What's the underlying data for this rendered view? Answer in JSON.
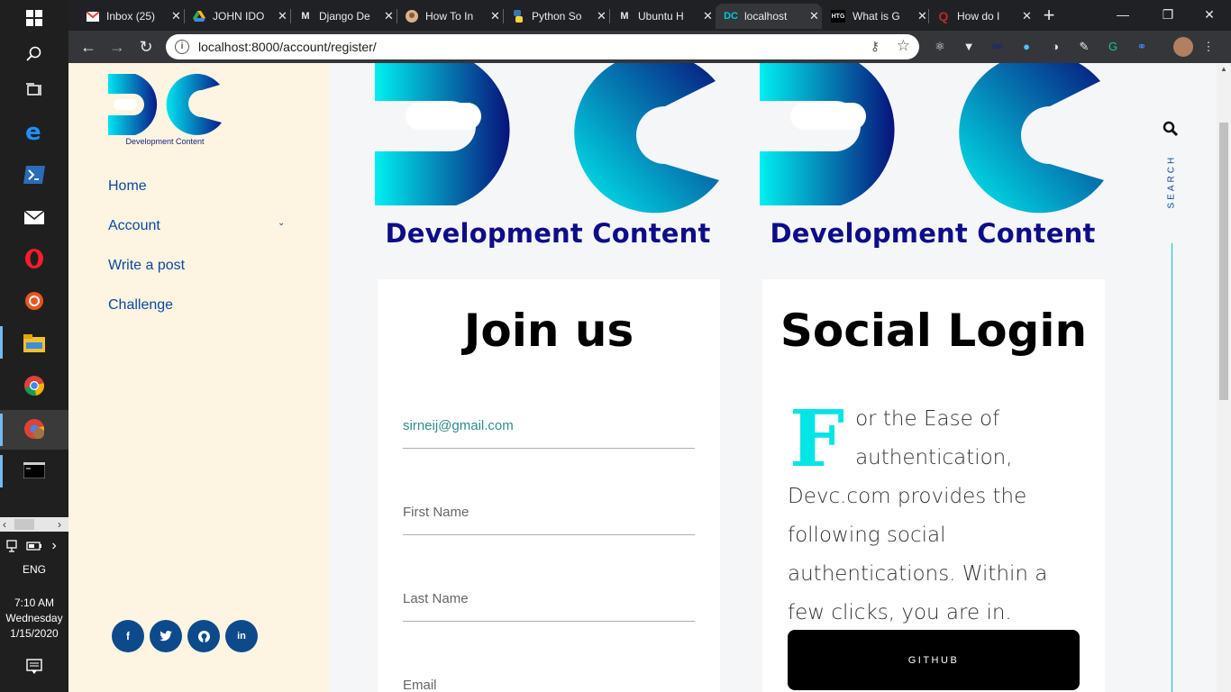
{
  "taskbar": {
    "language": "ENG",
    "time": "7:10 AM",
    "day": "Wednesday",
    "date": "1/15/2020"
  },
  "browser": {
    "tabs": [
      {
        "label": "Inbox (25)",
        "icon": "gmail-icon"
      },
      {
        "label": "JOHN IDO",
        "icon": "drive-icon"
      },
      {
        "label": "Django De",
        "icon": "medium-icon"
      },
      {
        "label": "How To In",
        "icon": "avatar-icon"
      },
      {
        "label": "Python So",
        "icon": "python-icon"
      },
      {
        "label": "Ubuntu H",
        "icon": "medium-icon"
      },
      {
        "label": "localhost",
        "icon": "dc-icon"
      },
      {
        "label": "What is G",
        "icon": "htg-icon"
      },
      {
        "label": "How do I",
        "icon": "quora-icon"
      }
    ],
    "url": "localhost:8000/account/register/"
  },
  "sidebar": {
    "brand_text": "Development Content",
    "nav": [
      "Home",
      "Account",
      "Write a post",
      "Challenge"
    ],
    "social": [
      "facebook-icon",
      "twitter-icon",
      "github-icon",
      "linkedin-icon"
    ]
  },
  "main": {
    "logo_caption": "Development Content",
    "join": {
      "title": "Join us",
      "email_value": "sirneij@gmail.com",
      "first_name_placeholder": "First Name",
      "last_name_placeholder": "Last Name",
      "email_placeholder": "Email"
    },
    "social_login": {
      "title": "Social Login",
      "drop_cap": "F",
      "text": "or the Ease of authentication, Devc.com provides the following social authentications. Within a few clicks, you are in.",
      "github_button": "GITHUB"
    },
    "search_label": "SEARCH"
  },
  "colors": {
    "brand_cyan": "#00e5e5",
    "brand_navy": "#0d0d8a",
    "nav_blue": "#0d47a1",
    "sidebar_bg": "#fdf5e1"
  }
}
